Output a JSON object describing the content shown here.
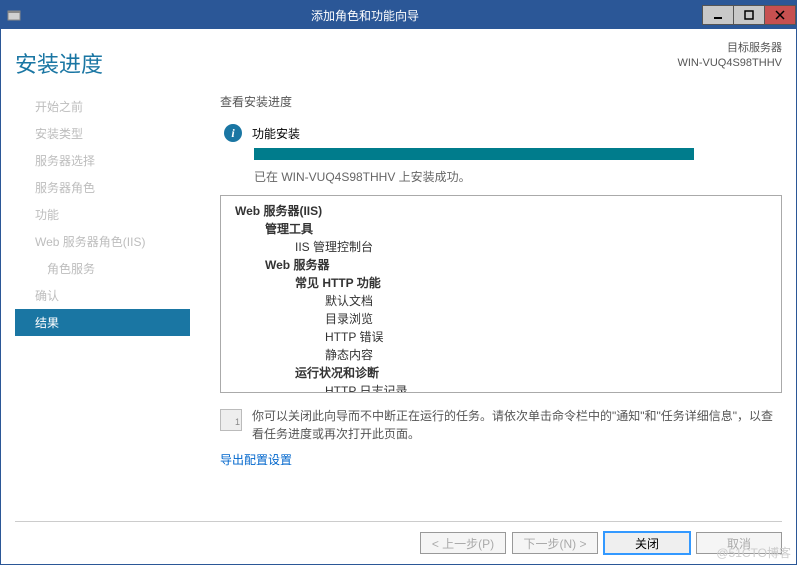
{
  "titlebar": {
    "title": "添加角色和功能向导"
  },
  "header": {
    "page_title": "安装进度",
    "server_label": "目标服务器",
    "server_name": "WIN-VUQ4S98THHV"
  },
  "sidebar": {
    "items": [
      {
        "label": "开始之前"
      },
      {
        "label": "安装类型"
      },
      {
        "label": "服务器选择"
      },
      {
        "label": "服务器角色"
      },
      {
        "label": "功能"
      },
      {
        "label": "Web 服务器角色(IIS)"
      },
      {
        "label": "角色服务"
      },
      {
        "label": "确认"
      },
      {
        "label": "结果"
      }
    ]
  },
  "main": {
    "section_label": "查看安装进度",
    "status_title": "功能安装",
    "status_text": "已在 WIN-VUQ4S98THHV 上安装成功。",
    "tree": {
      "l0": "Web 服务器(IIS)",
      "l1a": "管理工具",
      "l2a": "IIS 管理控制台",
      "l1b": "Web 服务器",
      "l2b": "常见 HTTP 功能",
      "l3a": "默认文档",
      "l3b": "目录浏览",
      "l3c": "HTTP 错误",
      "l3d": "静态内容",
      "l2c": "运行状况和诊断",
      "l3e": "HTTP 日志记录"
    },
    "note": "你可以关闭此向导而不中断正在运行的任务。请依次单击命令栏中的\"通知\"和\"任务详细信息\"，以查看任务进度或再次打开此页面。",
    "export_link": "导出配置设置"
  },
  "footer": {
    "prev": "< 上一步(P)",
    "next": "下一步(N) >",
    "close": "关闭",
    "cancel": "取消"
  },
  "watermark": "@51CTO博客"
}
